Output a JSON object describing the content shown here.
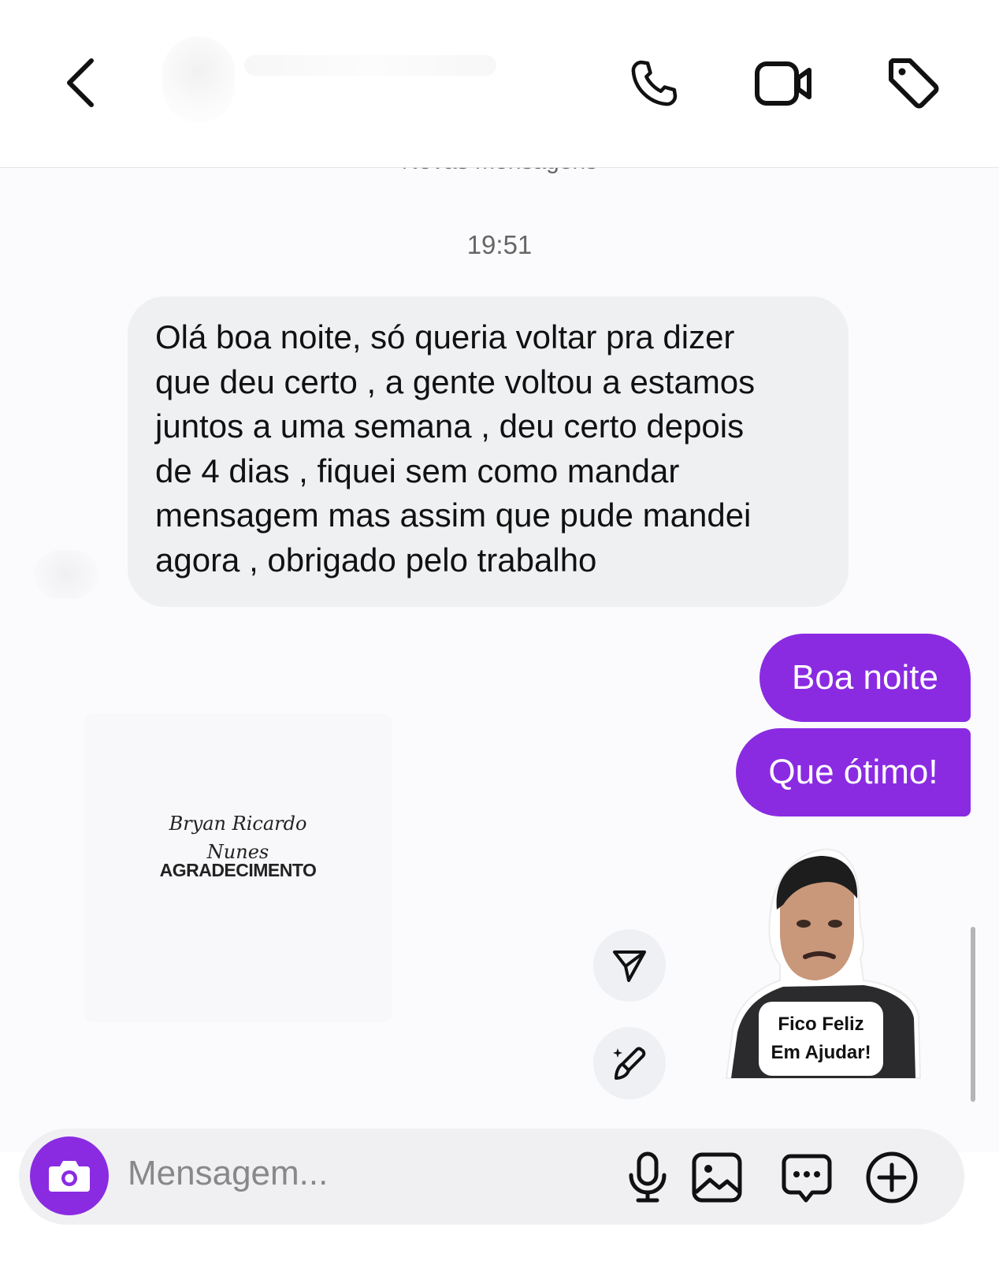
{
  "header": {
    "back_icon": "chevron-left-icon",
    "call_icon": "phone-icon",
    "video_icon": "video-camera-icon",
    "tag_icon": "tag-icon"
  },
  "thread": {
    "new_messages_label": "Novas mensagens",
    "timestamp": "19:51",
    "incoming_message": "Olá boa noite, só queria voltar pra dizer\nque deu certo , a gente voltou a estamos\njuntos a uma semana , deu certo depois\nde 4 dias , fiquei sem como mandar\nmensagem mas assim que pude mandei\nagora , obrigado pelo trabalho",
    "outgoing_messages": [
      "Boa noite",
      "Que ótimo!"
    ],
    "card": {
      "script_name": "Bryan Ricardo\nNunes",
      "title": "AGRADECIMENTO"
    },
    "sticker": {
      "line1": "Fico Feliz",
      "line2": "Em Ajudar!"
    }
  },
  "composer": {
    "placeholder": "Mensagem..."
  },
  "colors": {
    "accent": "#8a2be2",
    "bubble_incoming": "#eff0f2",
    "background": "#fbfbfd"
  }
}
